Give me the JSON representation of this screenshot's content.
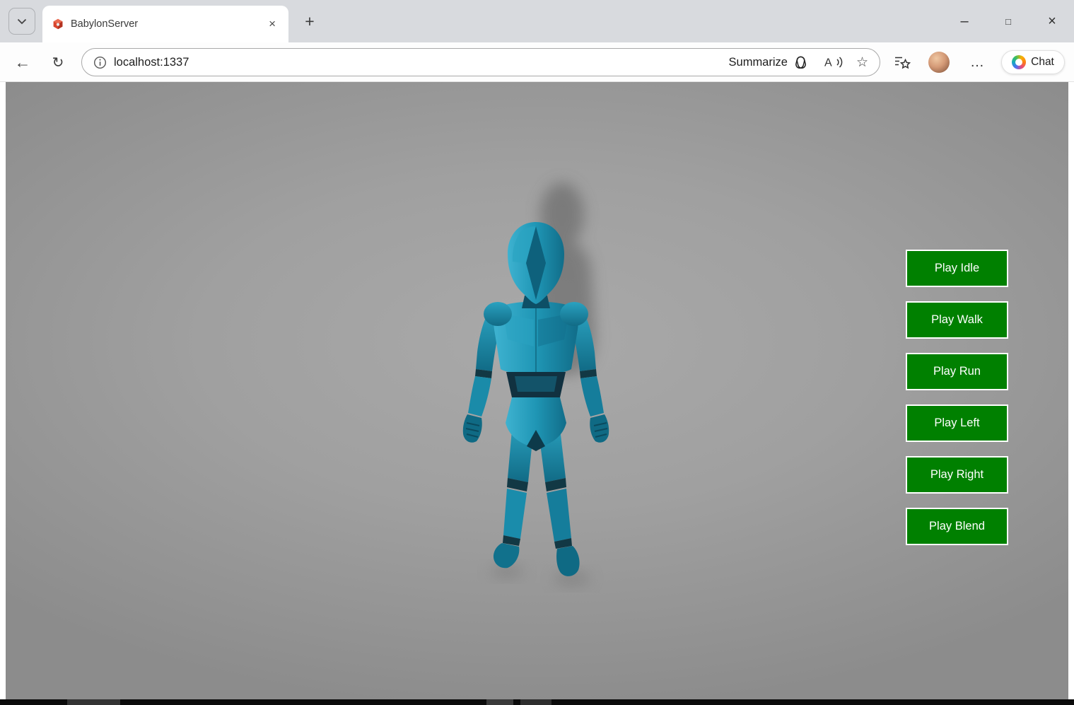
{
  "tab": {
    "title": "BabylonServer"
  },
  "address_bar": {
    "url": "localhost:1337",
    "summarize_label": "Summarize"
  },
  "browser": {
    "chat_label": "Chat"
  },
  "glyphs": {
    "new_tab": "+",
    "close_tab": "×",
    "minimize": "–",
    "maximize": "□",
    "close_window": "×",
    "back": "←",
    "refresh": "↻",
    "star": "☆",
    "more": "…",
    "tab_dropdown": "chevron-down",
    "favicon": "babylon-red-logo",
    "site_info": "circle-i",
    "summarize_icon": "copilot-outline",
    "read_aloud": "A-with-sound-waves",
    "favorites_hub": "star-with-list-lines",
    "avatar": "user-profile-photo",
    "chat_icon": "copilot-color-swirl"
  },
  "scene": {
    "buttons": [
      "Play Idle",
      "Play Walk",
      "Play Run",
      "Play Left",
      "Play Right",
      "Play Blend"
    ],
    "character": "teal humanoid dummy robot standing on gray ground with cast shadow"
  },
  "colors": {
    "button_green": "#008000",
    "button_border": "#ffffff",
    "button_text": "#ffffff",
    "character_teal": "#1f96b5",
    "canvas_gray": "#9c9c9c",
    "tabstrip_gray": "#d8dade"
  }
}
